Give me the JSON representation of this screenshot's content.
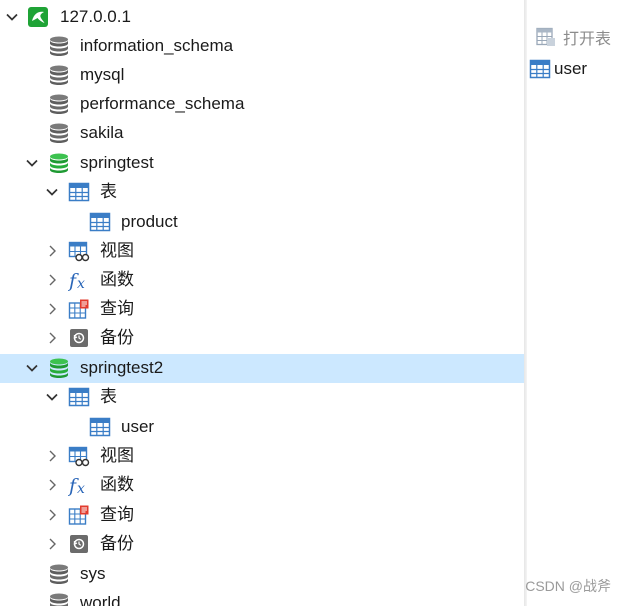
{
  "tree": {
    "connection": "127.0.0.1",
    "databases": {
      "information_schema": "information_schema",
      "mysql": "mysql",
      "performance_schema": "performance_schema",
      "sakila": "sakila",
      "springtest": "springtest",
      "springtest2": "springtest2",
      "sys": "sys",
      "world": "world"
    },
    "springtest": {
      "tables": "表",
      "table_product": "product",
      "views": "视图",
      "functions": "函数",
      "queries": "查询",
      "backups": "备份"
    },
    "springtest2": {
      "tables": "表",
      "table_user": "user",
      "views": "视图",
      "functions": "函数",
      "queries": "查询",
      "backups": "备份"
    }
  },
  "right_pane": {
    "open_table_label": "打开表",
    "items": [
      "user"
    ]
  },
  "watermark": "CSDN @战斧",
  "colors": {
    "selection": "#cce8ff",
    "db_green": "#1fa336",
    "db_gray": "#6f6f6f",
    "table_blue": "#3a7dc6"
  }
}
